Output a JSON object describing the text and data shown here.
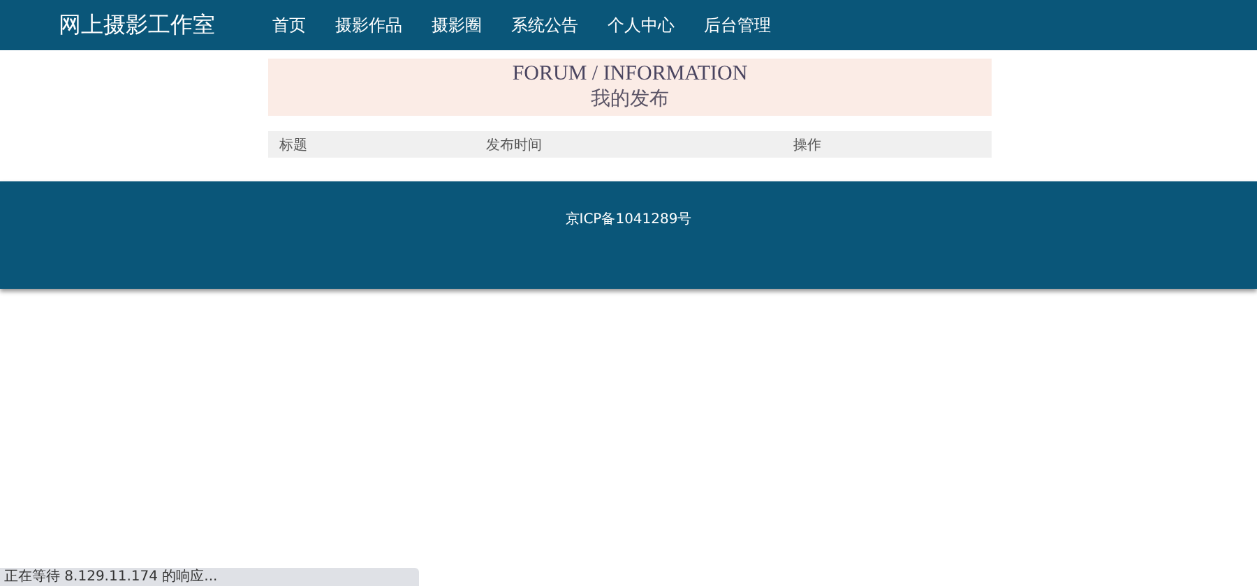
{
  "header": {
    "site_title": "网上摄影工作室",
    "nav": [
      {
        "label": "首页"
      },
      {
        "label": "摄影作品"
      },
      {
        "label": "摄影圈"
      },
      {
        "label": "系统公告"
      },
      {
        "label": "个人中心"
      },
      {
        "label": "后台管理"
      }
    ]
  },
  "banner": {
    "title": "FORUM / INFORMATION",
    "subtitle": "我的发布"
  },
  "table": {
    "columns": [
      "标题",
      "发布时间",
      "操作"
    ]
  },
  "footer": {
    "icp": "京ICP备1041289号"
  },
  "status_bar": "正在等待 8.129.11.174 的响应..."
}
